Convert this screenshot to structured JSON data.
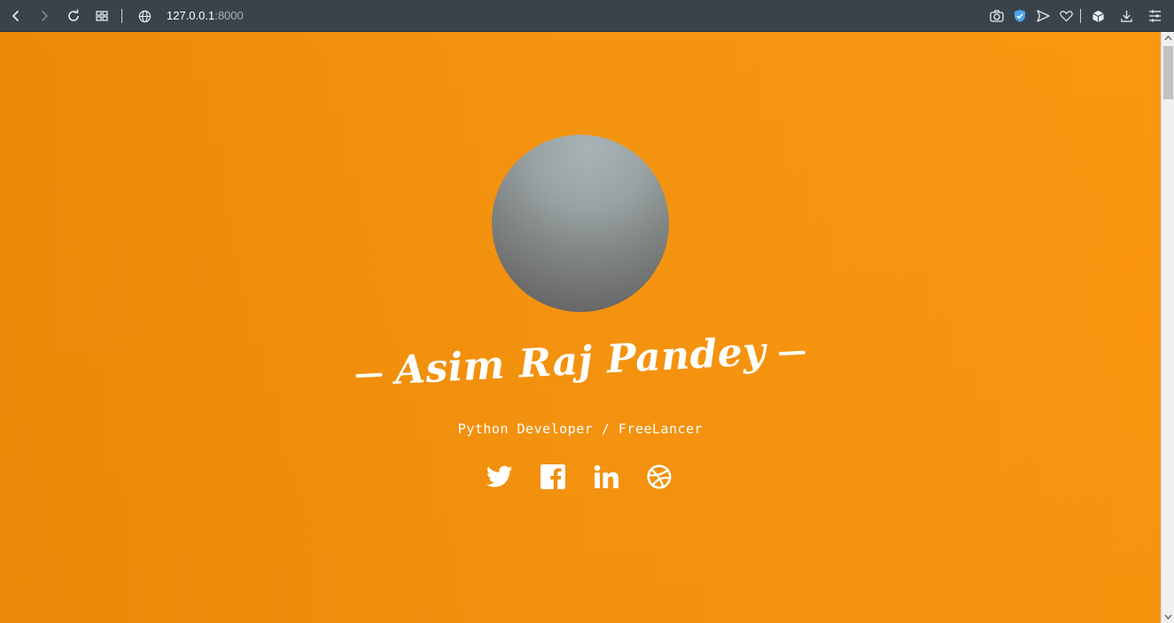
{
  "browser": {
    "url_host": "127.0.0.1",
    "url_port": ":8000",
    "icons": [
      "back-icon",
      "forward-icon",
      "reload-icon",
      "tab-grid-icon",
      "globe-icon",
      "camera-icon",
      "shield-icon",
      "send-icon",
      "heart-icon",
      "box-icon",
      "download-icon",
      "menu-icon"
    ]
  },
  "hero": {
    "name": "Asim Raj Pandey",
    "subtitle": "Python Developer / FreeLancer",
    "socials": [
      "twitter-icon",
      "facebook-icon",
      "linkedin-icon",
      "dribbble-icon"
    ]
  },
  "colors": {
    "page_background": "#f0900c",
    "toolbar": "#3a434c",
    "text": "#ffffff"
  }
}
